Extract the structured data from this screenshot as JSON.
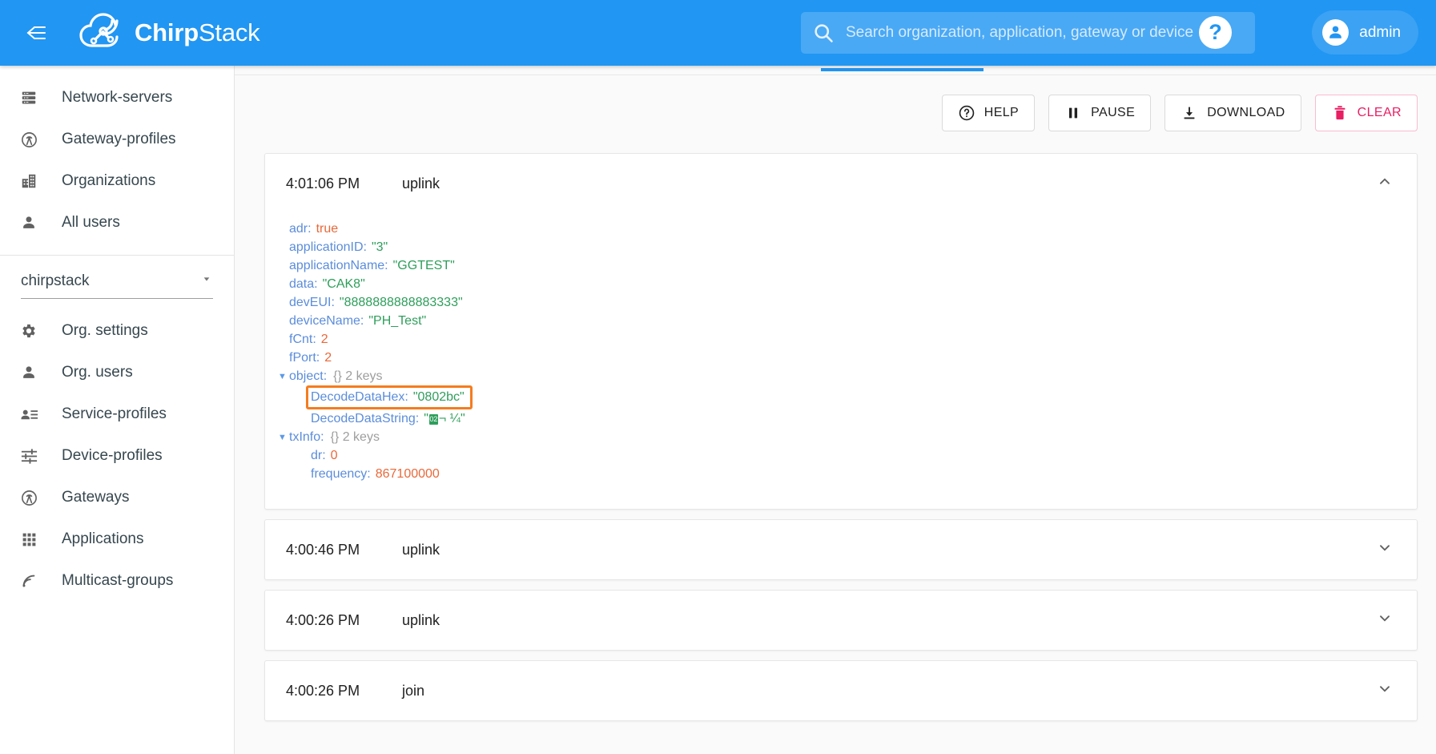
{
  "header": {
    "menu_icon": "collapse-menu-icon",
    "brand_bold": "Chirp",
    "brand_light": "Stack",
    "search": {
      "icon": "search-icon",
      "placeholder": "Search organization, application, gateway or device",
      "value": ""
    },
    "help_icon_label": "?",
    "user": {
      "avatar_icon": "account-circle-icon",
      "name": "admin"
    },
    "accent_color": "#2196f3"
  },
  "sidebar": {
    "global_items": [
      {
        "label": "Network-servers",
        "icon": "server-icon"
      },
      {
        "label": "Gateway-profiles",
        "icon": "antenna-icon"
      },
      {
        "label": "Organizations",
        "icon": "building-icon"
      },
      {
        "label": "All users",
        "icon": "person-icon"
      }
    ],
    "organization": {
      "selected": "chirpstack",
      "caret_icon": "chevron-down-icon"
    },
    "org_items": [
      {
        "label": "Org. settings",
        "icon": "gear-icon"
      },
      {
        "label": "Org. users",
        "icon": "person-icon"
      },
      {
        "label": "Service-profiles",
        "icon": "person-list-icon"
      },
      {
        "label": "Device-profiles",
        "icon": "sliders-icon"
      },
      {
        "label": "Gateways",
        "icon": "antenna-icon"
      },
      {
        "label": "Applications",
        "icon": "apps-grid-icon"
      },
      {
        "label": "Multicast-groups",
        "icon": "rss-broadcast-icon"
      }
    ]
  },
  "toolbar": {
    "buttons": [
      {
        "label": "HELP",
        "icon": "help-circle-icon",
        "style": "default"
      },
      {
        "label": "PAUSE",
        "icon": "pause-icon",
        "style": "default"
      },
      {
        "label": "DOWNLOAD",
        "icon": "download-icon",
        "style": "default"
      },
      {
        "label": "CLEAR",
        "icon": "trash-icon",
        "style": "danger"
      }
    ],
    "danger_color": "#e91e63"
  },
  "events": {
    "expanded": {
      "time": "4:01:06 PM",
      "type": "uplink",
      "chevron_icon": "chevron-up-icon",
      "fields": {
        "adr_key": "adr:",
        "adr_value": "true",
        "applicationID_key": "applicationID:",
        "applicationID_value": "\"3\"",
        "applicationName_key": "applicationName:",
        "applicationName_value": "\"GGTEST\"",
        "data_key": "data:",
        "data_value": "\"CAK8\"",
        "devEUI_key": "devEUI:",
        "devEUI_value": "\"8888888888883333\"",
        "deviceName_key": "deviceName:",
        "deviceName_value": "\"PH_Test\"",
        "fCnt_key": "fCnt:",
        "fCnt_value": "2",
        "fPort_key": "fPort:",
        "fPort_value": "2",
        "object_key": "object:",
        "object_meta": "{} 2 keys",
        "DecodeDataHex_key": "DecodeDataHex:",
        "DecodeDataHex_value": "\"0802bc\"",
        "DecodeDataString_key": "DecodeDataString:",
        "DecodeDataString_prefix": "\"",
        "DecodeDataString_glyph": "02",
        "DecodeDataString_mid": "¬",
        "DecodeDataString_suffix": " ¼\"",
        "txInfo_key": "txInfo:",
        "txInfo_meta": "{} 2 keys",
        "dr_key": "dr:",
        "dr_value": "0",
        "frequency_key": "frequency:",
        "frequency_value": "867100000"
      },
      "highlight_color": "#f57c1f"
    },
    "collapsed": [
      {
        "time": "4:00:46 PM",
        "type": "uplink",
        "chevron_icon": "chevron-down-icon"
      },
      {
        "time": "4:00:26 PM",
        "type": "uplink",
        "chevron_icon": "chevron-down-icon"
      },
      {
        "time": "4:00:26 PM",
        "type": "join",
        "chevron_icon": "chevron-down-icon"
      }
    ]
  }
}
